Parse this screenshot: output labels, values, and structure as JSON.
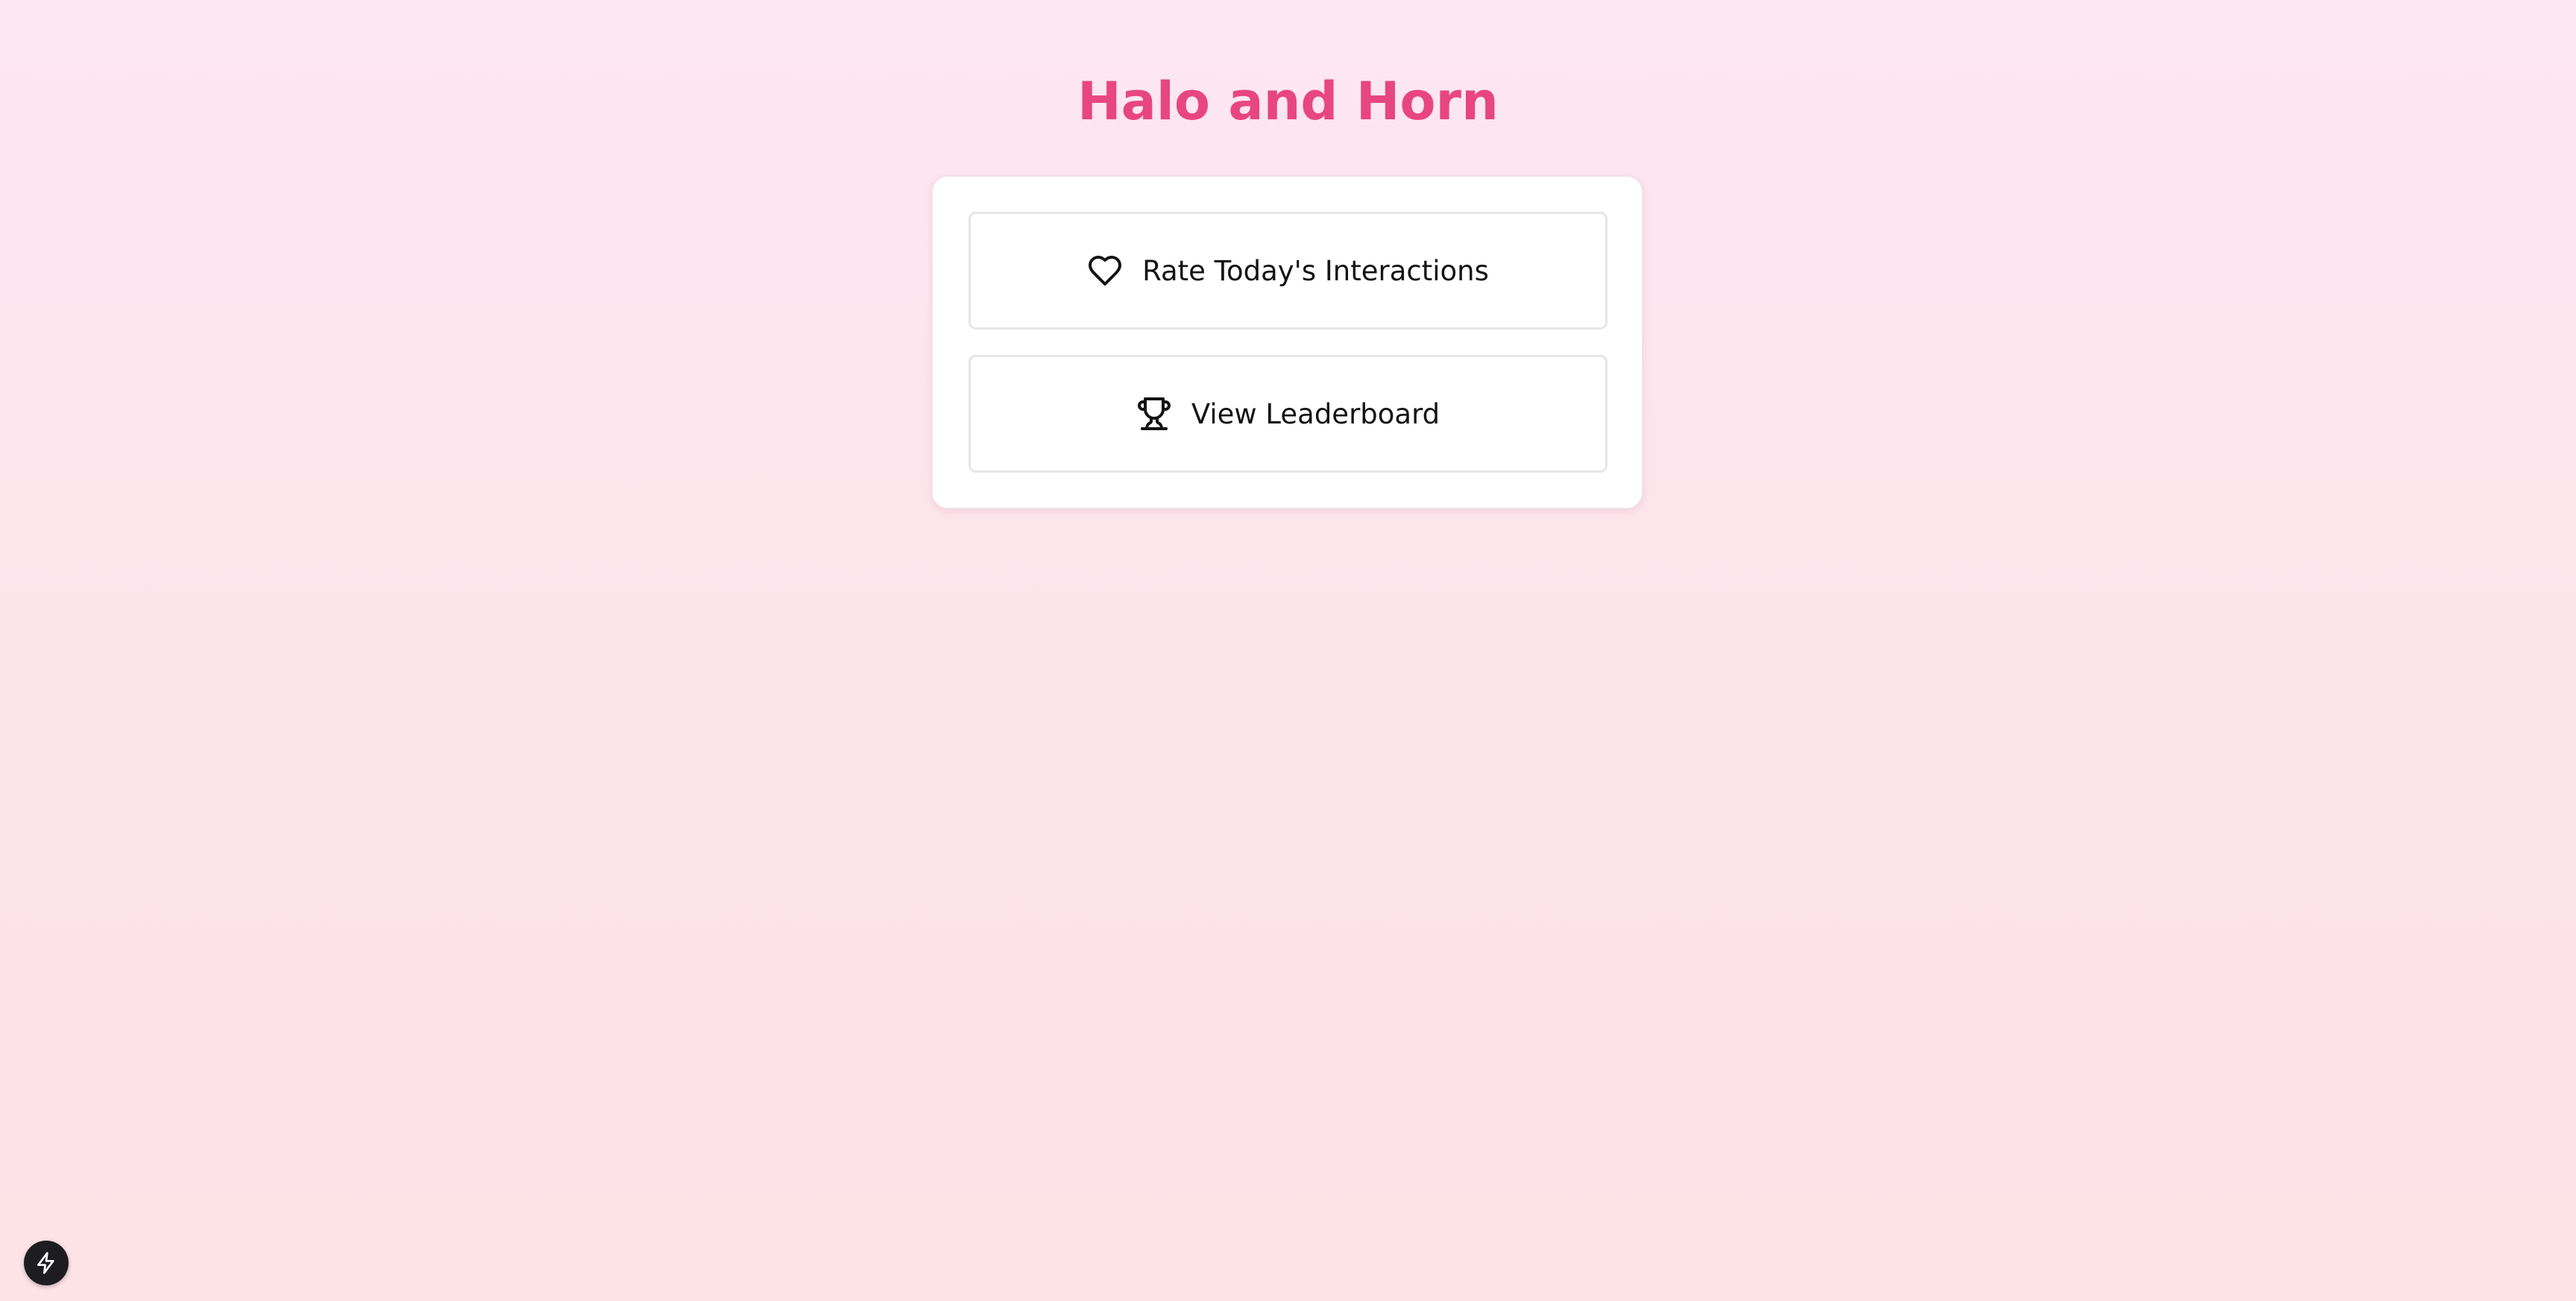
{
  "header": {
    "title": "Halo and Horn"
  },
  "menu": {
    "buttons": [
      {
        "label": "Rate Today's Interactions",
        "icon": "heart-icon"
      },
      {
        "label": "View Leaderboard",
        "icon": "trophy-icon"
      }
    ]
  },
  "badge": {
    "icon": "lightning-icon"
  },
  "colors": {
    "title": "#e8467f",
    "background_top": "#fde7f2",
    "background_bottom": "#fde2e6",
    "badge": "#1d1d1f"
  }
}
